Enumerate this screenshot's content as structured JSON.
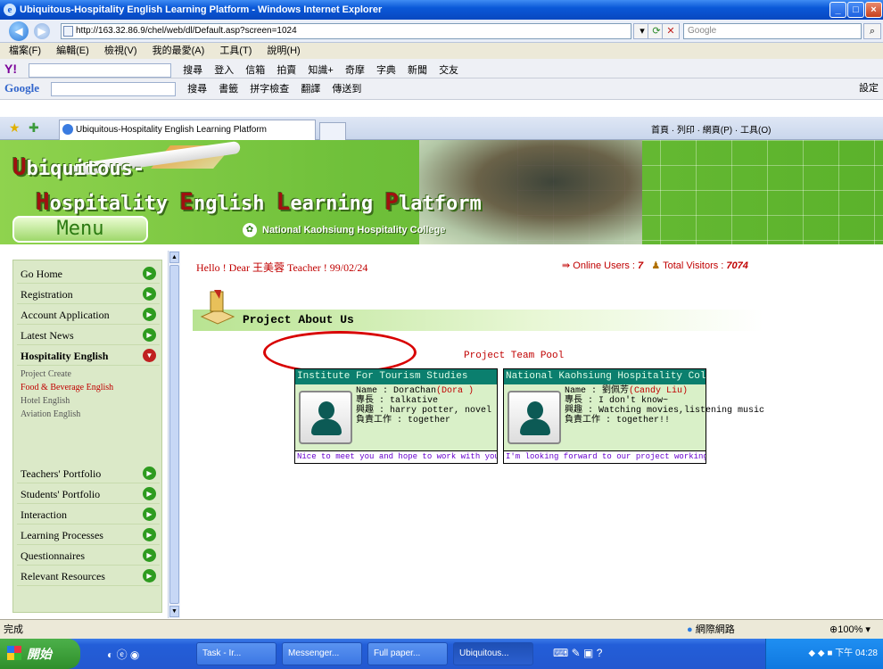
{
  "window": {
    "title": "Ubiquitous-Hospitality English Learning Platform - Windows Internet Explorer"
  },
  "address": {
    "url": "http://163.32.86.9/chel/web/dl/Default.asp?screen=1024",
    "search_placeholder": "Google"
  },
  "menubar": [
    "檔案(F)",
    "編輯(E)",
    "檢視(V)",
    "我的最愛(A)",
    "工具(T)",
    "說明(H)"
  ],
  "toolbar_yahoo": {
    "logo": "Y!",
    "items": [
      "搜尋",
      "登入",
      "信箱",
      "拍賣",
      "知識+",
      "奇摩",
      "字典",
      "新聞",
      "交友"
    ]
  },
  "toolbar_google": {
    "logo": "Google",
    "items": [
      "搜尋",
      "書籤",
      "拼字檢查",
      "翻譯",
      "傳送到",
      "設定"
    ]
  },
  "tab": {
    "label": "Ubiquitous-Hospitality English Learning Platform",
    "tools": [
      "首頁",
      "列印",
      "網頁(P)",
      "工具(O)"
    ]
  },
  "banner": {
    "line1_first": "U",
    "line1_rest": "biquitous-",
    "line2": [
      {
        "cap": "H",
        "rest": "ospitality "
      },
      {
        "cap": "E",
        "rest": "nglish "
      },
      {
        "cap": "L",
        "rest": "earning "
      },
      {
        "cap": "P",
        "rest": "latform"
      }
    ],
    "college": "National Kaohsiung Hospitality College",
    "menu_label": "Menu"
  },
  "sidebar": {
    "items": [
      {
        "label": "Go Home"
      },
      {
        "label": "Registration"
      },
      {
        "label": "Account Application"
      },
      {
        "label": "Latest News"
      },
      {
        "label": "Hospitality English"
      },
      {
        "label": "Teachers' Portfolio"
      },
      {
        "label": "Students' Portfolio"
      },
      {
        "label": "Interaction"
      },
      {
        "label": "Learning Processes"
      },
      {
        "label": "Questionnaires"
      },
      {
        "label": "Relevant Resources"
      }
    ],
    "subitems": [
      {
        "label": "Project Create"
      },
      {
        "label": "Food & Beverage English"
      },
      {
        "label": "Hotel English"
      },
      {
        "label": "Aviation English"
      }
    ]
  },
  "main": {
    "greeting": "Hello ! Dear 王美蓉 Teacher ! 99/02/24",
    "online_label": "Online Users :",
    "online_count": "7",
    "visitors_label": "Total Visitors :",
    "visitors_count": "7074",
    "section_title": "Project About Us",
    "team_title": "Project Team Pool"
  },
  "cards": [
    {
      "header": "Institute For Tourism Studies",
      "name_label": "Name : DoraChan",
      "name_red": "(Dora )",
      "line2": "專長 : talkative",
      "line3": "興趣 : harry potter, novel",
      "line4": "負責工作 : together",
      "footer": "Nice to meet you and hope to work with you!"
    },
    {
      "header": "National Kaohsiung Hospitality College",
      "name_label": "Name : 劉佩芳",
      "name_red": "(Candy Liu)",
      "line2": "專長 : I don't know~",
      "line3": "興趣 : Watching movies,listening music",
      "line4": "負責工作 : together!!",
      "footer": "I'm looking forward to our project working"
    }
  ],
  "status": {
    "left": "完成",
    "zone": "網際網路",
    "zoom": "100%"
  },
  "taskbar": {
    "start": "開始",
    "buttons": [
      "Task - Ir...",
      "Messenger...",
      "Full paper...",
      "Ubiquitous..."
    ],
    "clock": "下午 04:28"
  }
}
